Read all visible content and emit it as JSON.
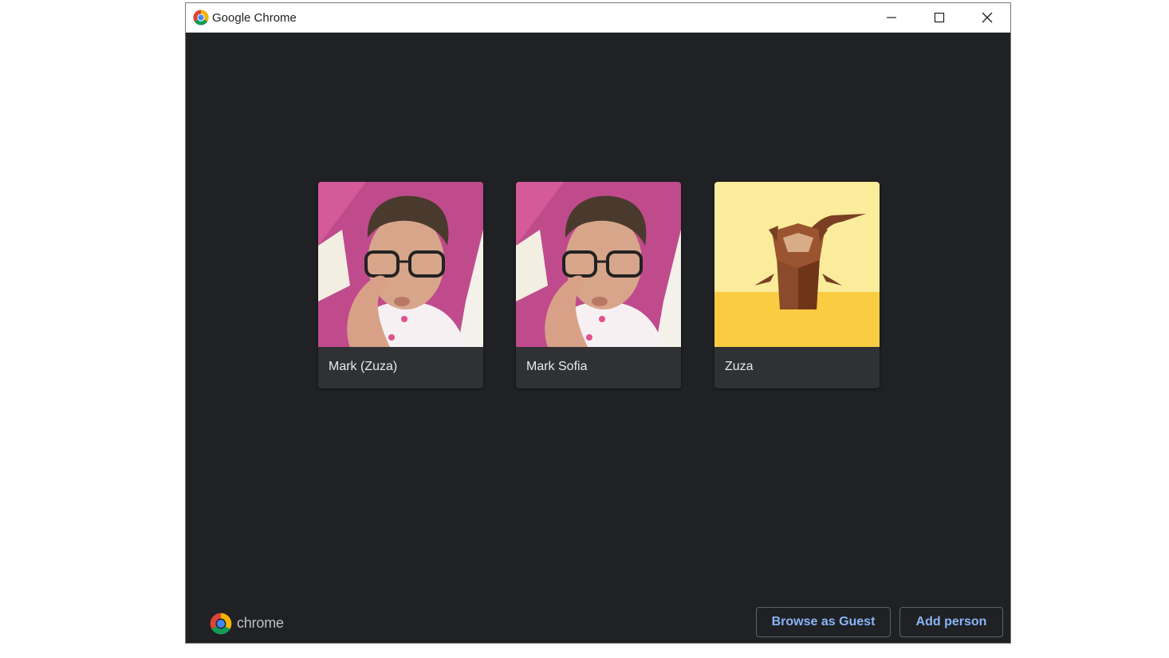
{
  "window": {
    "title": "Google Chrome",
    "controls": [
      "minimize-icon",
      "maximize-icon",
      "close-icon"
    ]
  },
  "profiles": [
    {
      "name": "Mark (Zuza)",
      "avatar": "person-photo"
    },
    {
      "name": "Mark Sofia",
      "avatar": "person-photo"
    },
    {
      "name": "Zuza",
      "avatar": "origami-monkey"
    }
  ],
  "brand": {
    "label": "chrome"
  },
  "actions": {
    "guest_label": "Browse as Guest",
    "add_label": "Add person"
  },
  "colors": {
    "background": "#202124",
    "card": "#303134",
    "accent": "#8ab4f8"
  }
}
